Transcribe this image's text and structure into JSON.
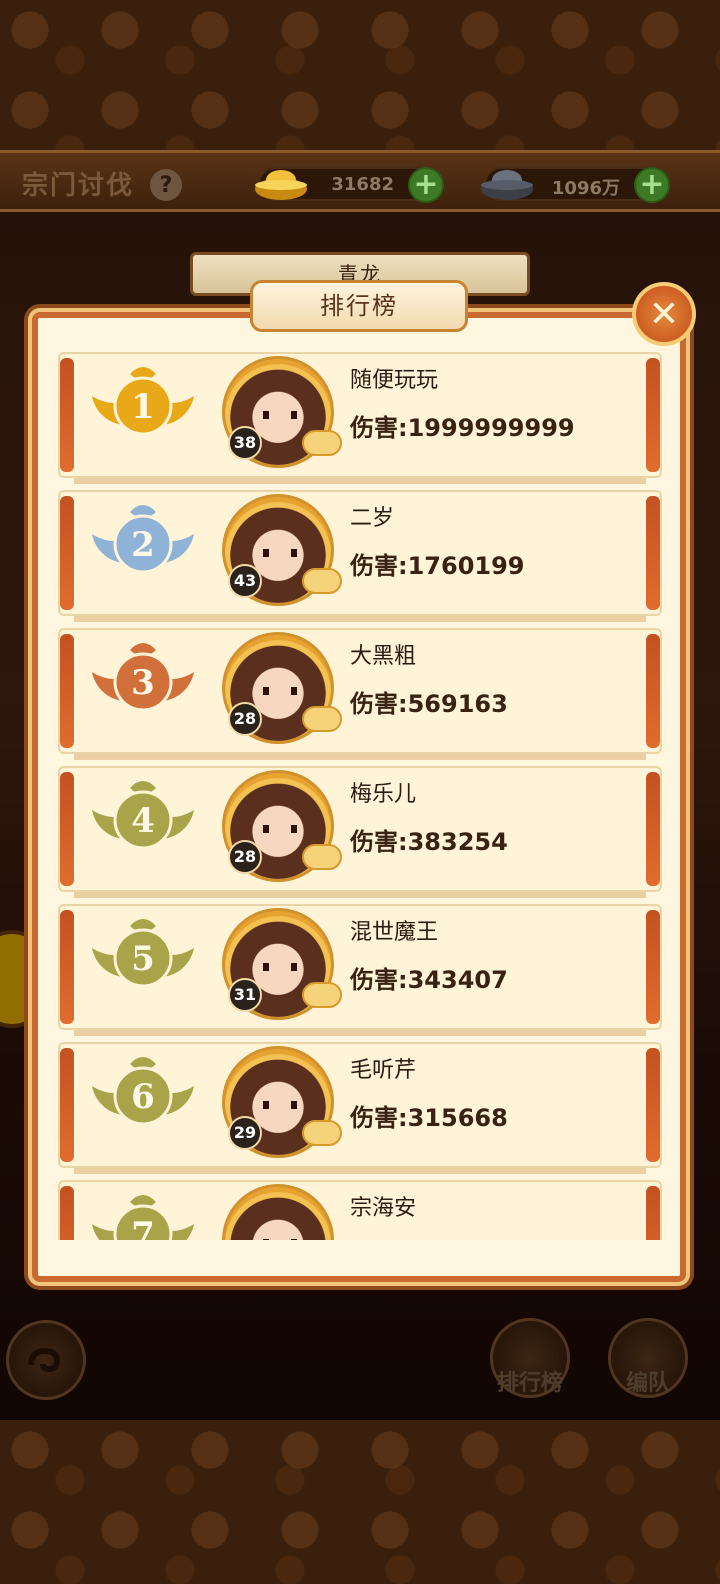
{
  "header": {
    "title": "宗门讨伐",
    "gold_amount": "31682",
    "silver_amount": "1096万"
  },
  "boss": {
    "name": "青龙"
  },
  "modal": {
    "title": "排行榜",
    "rows": [
      {
        "rank": "1",
        "level": "38",
        "name": "随便玩玩",
        "damage": "伤害:1999999999",
        "medal_color": "#e8a818"
      },
      {
        "rank": "2",
        "level": "43",
        "name": "二岁",
        "damage": "伤害:1760199",
        "medal_color": "#8fb3d6"
      },
      {
        "rank": "3",
        "level": "28",
        "name": "大黑粗",
        "damage": "伤害:569163",
        "medal_color": "#d2703b"
      },
      {
        "rank": "4",
        "level": "28",
        "name": "梅乐儿",
        "damage": "伤害:383254",
        "medal_color": "#a9a34a"
      },
      {
        "rank": "5",
        "level": "31",
        "name": "混世魔王",
        "damage": "伤害:343407",
        "medal_color": "#a9a34a"
      },
      {
        "rank": "6",
        "level": "29",
        "name": "毛听芹",
        "damage": "伤害:315668",
        "medal_color": "#a9a34a"
      },
      {
        "rank": "7",
        "level": "",
        "name": "宗海安",
        "damage": "",
        "medal_color": "#a9a34a"
      }
    ]
  },
  "bottom": {
    "rank_label": "排行榜",
    "team_label": "编队"
  }
}
